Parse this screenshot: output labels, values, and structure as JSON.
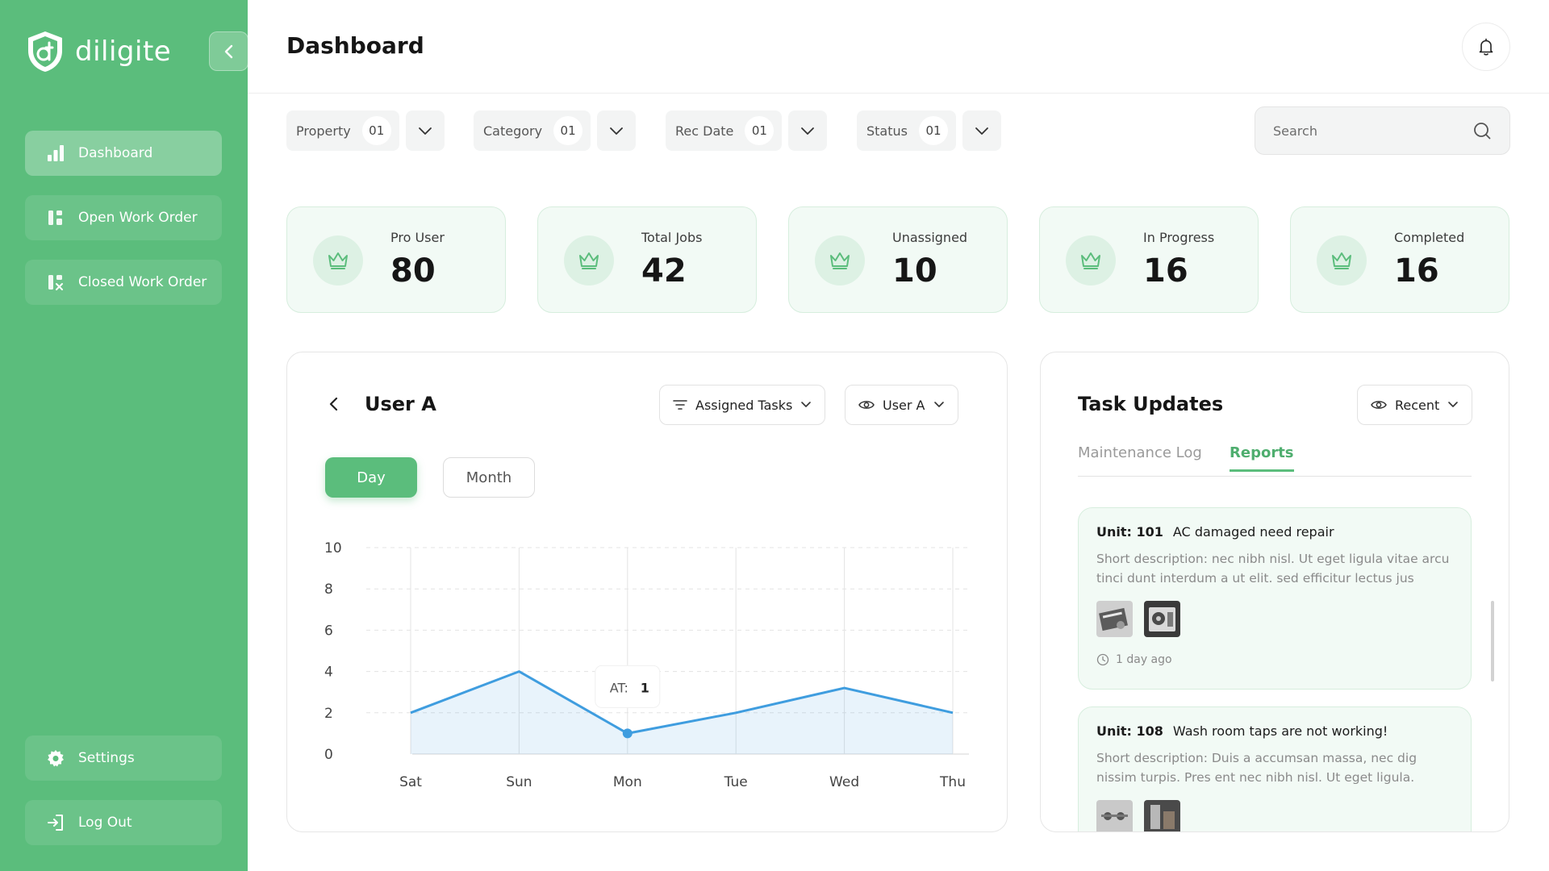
{
  "app": {
    "name": "diligite"
  },
  "sidebar": {
    "items": [
      {
        "label": "Dashboard",
        "icon": "bar-chart-icon",
        "active": true
      },
      {
        "label": "Open Work Order",
        "icon": "work-order-icon",
        "active": false
      },
      {
        "label": "Closed Work Order",
        "icon": "closed-work-order-icon",
        "active": false
      }
    ],
    "settings_label": "Settings",
    "logout_label": "Log Out"
  },
  "header": {
    "title": "Dashboard"
  },
  "filters": [
    {
      "label": "Property",
      "count": "01"
    },
    {
      "label": "Category",
      "count": "01"
    },
    {
      "label": "Rec Date",
      "count": "01"
    },
    {
      "label": "Status",
      "count": "01"
    }
  ],
  "search": {
    "placeholder": "Search"
  },
  "stats": [
    {
      "label": "Pro User",
      "value": "80"
    },
    {
      "label": "Total Jobs",
      "value": "42"
    },
    {
      "label": "Unassigned",
      "value": "10"
    },
    {
      "label": "In Progress",
      "value": "16"
    },
    {
      "label": "Completed",
      "value": "16"
    }
  ],
  "chart_panel": {
    "user": "User A",
    "filter_label": "Assigned Tasks",
    "user_select": "User A",
    "segments": {
      "day": "Day",
      "month": "Month"
    },
    "tooltip": {
      "label": "AT:",
      "value": "1"
    }
  },
  "chart_data": {
    "type": "area",
    "categories": [
      "Sat",
      "Sun",
      "Mon",
      "Tue",
      "Wed",
      "Thu"
    ],
    "series": [
      {
        "values": [
          2,
          4,
          1,
          2,
          3.2,
          2
        ]
      }
    ],
    "yticks": [
      0,
      2,
      4,
      6,
      8,
      10
    ],
    "ylim": [
      0,
      10
    ],
    "grid": true,
    "highlighted_index": 2,
    "color": "#3f9ddf"
  },
  "task_panel": {
    "title": "Task Updates",
    "filter_label": "Recent",
    "tabs": [
      {
        "label": "Maintenance Log",
        "active": false
      },
      {
        "label": "Reports",
        "active": true
      }
    ],
    "items": [
      {
        "unit": "Unit: 101",
        "title": "AC damaged need repair",
        "description": "Short description: nec nibh nisl. Ut eget ligula vitae arcu tinci dunt interdum a ut elit. sed efficitur lectus jus",
        "time": "1 day ago"
      },
      {
        "unit": "Unit: 108",
        "title": "Wash room taps are not working!",
        "description": "Short description: Duis a accumsan massa, nec dig nissim turpis. Pres ent nec nibh nisl. Ut eget ligula.",
        "time": ""
      }
    ]
  },
  "colors": {
    "brand": "#5bbd7c",
    "chart_line": "#3f9ddf",
    "card_bg": "#f2faf5"
  }
}
